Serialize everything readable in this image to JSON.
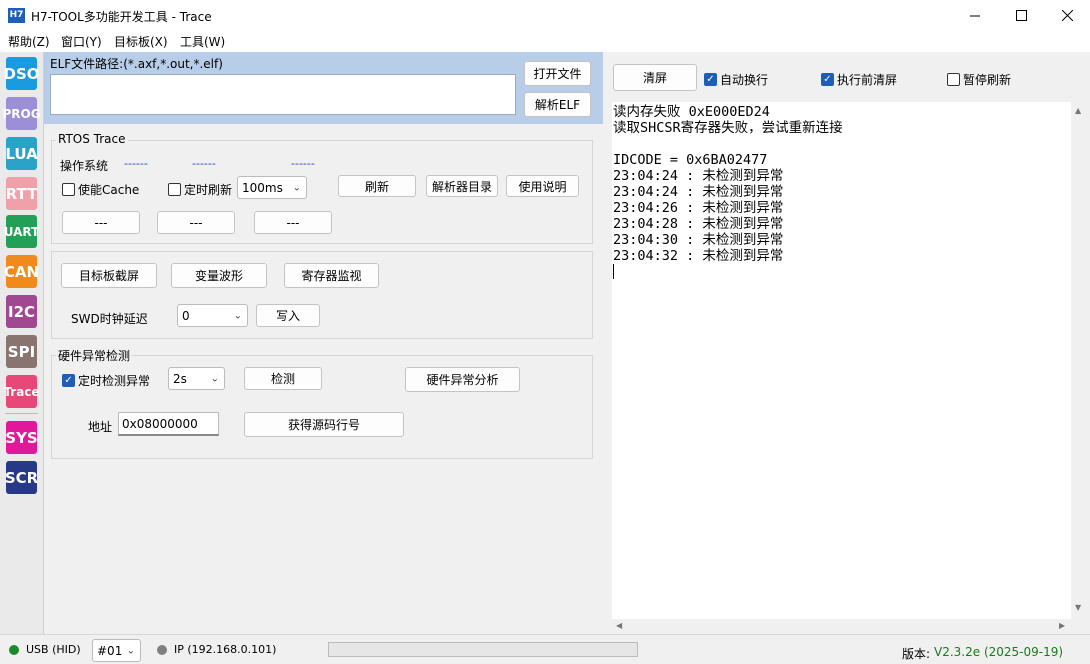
{
  "window": {
    "title": "H7-TOOL多功能开发工具 - Trace",
    "icon_text": "H7"
  },
  "menu": [
    "帮助(Z)",
    "窗口(Y)",
    "目标板(X)",
    "工具(W)"
  ],
  "tools": [
    {
      "label": "DSO",
      "color": "#1a9be0"
    },
    {
      "label": "PROG",
      "color": "#9d8ed8"
    },
    {
      "label": "LUA",
      "color": "#2ba3c8"
    },
    {
      "label": "RTT",
      "color": "#f0a0a8"
    },
    {
      "label": "UART",
      "color": "#22a058"
    },
    {
      "label": "CAN",
      "color": "#f08a1c"
    },
    {
      "label": "I2C",
      "color": "#a04890"
    },
    {
      "label": "SPI",
      "color": "#8a7470"
    },
    {
      "label": "Trace",
      "color": "#e84878"
    },
    {
      "label": "SYS",
      "color": "#e0189a"
    },
    {
      "label": "SCR",
      "color": "#283888"
    }
  ],
  "elf": {
    "label": "ELF文件路径:(*.axf,*.out,*.elf)",
    "path": "",
    "open_btn": "打开文件",
    "parse_btn": "解析ELF"
  },
  "rtos": {
    "legend": "RTOS Trace",
    "os_label": "操作系统",
    "dash": [
      "------",
      "------",
      "------"
    ],
    "cache_label": "使能Cache",
    "timer_label": "定时刷新",
    "interval": "100ms",
    "refresh_btn": "刷新",
    "parser_dir_btn": "解析器目录",
    "help_btn": "使用说明",
    "small_btns": [
      "---",
      "---",
      "---"
    ]
  },
  "tools_group": {
    "screenshot_btn": "目标板截屏",
    "var_wave_btn": "变量波形",
    "reg_monitor_btn": "寄存器监视",
    "swd_label": "SWD时钟延迟",
    "swd_value": "0",
    "write_btn": "写入"
  },
  "fault": {
    "legend": "硬件异常检测",
    "timer_check_label": "定时检测异常",
    "interval": "2s",
    "check_btn": "检测",
    "analyze_btn": "硬件异常分析",
    "addr_label": "地址",
    "addr_value": "0x08000000",
    "get_line_btn": "获得源码行号"
  },
  "right": {
    "clear_btn": "清屏",
    "auto_wrap": "自动换行",
    "clear_before": "执行前清屏",
    "pause_refresh": "暂停刷新"
  },
  "log_lines": [
    "读内存失败 0xE000ED24",
    "读取SHCSR寄存器失败，尝试重新连接",
    "",
    "IDCODE = 0x6BA02477",
    "23:04:24 : 未检测到异常",
    "23:04:24 : 未检测到异常",
    "23:04:26 : 未检测到异常",
    "23:04:28 : 未检测到异常",
    "23:04:30 : 未检测到异常",
    "23:04:32 : 未检测到异常"
  ],
  "status": {
    "usb": "USB (HID)",
    "device": "#01",
    "ip": "IP (192.168.0.101)",
    "version_label": "版本:",
    "version_value": "V2.3.2e (2025-09-19)"
  }
}
